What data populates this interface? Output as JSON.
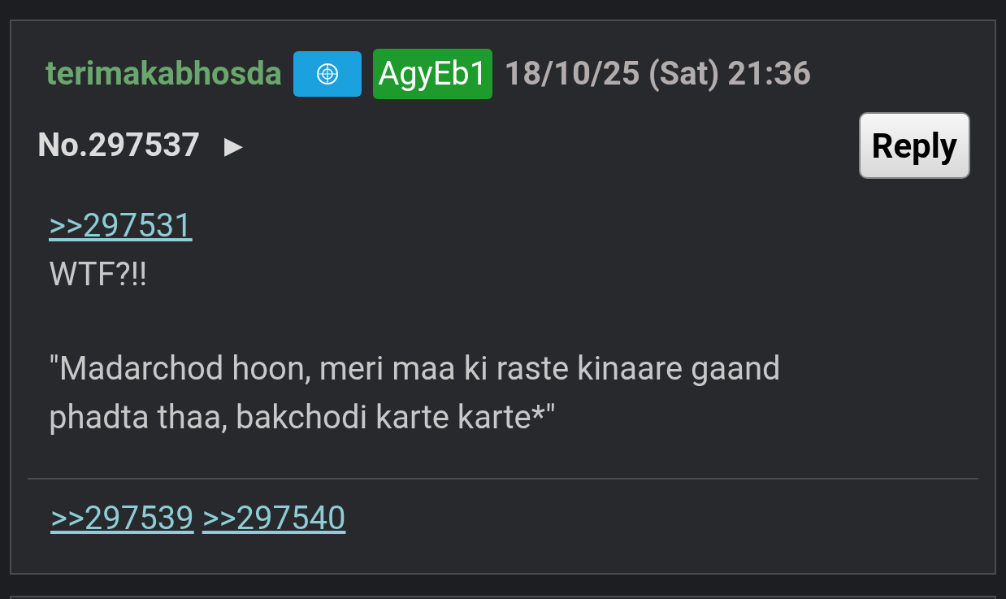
{
  "post": {
    "name": "terimakabhosda",
    "poster_id": "AgyEb1",
    "date": "18/10/25 (Sat) 21:36",
    "number": "No.297537",
    "expand_glyph": "▶",
    "reply_button": "Reply",
    "quote_link": ">>297531",
    "body": [
      "WTF?!!",
      " ″Madarchod hoon, meri maa ki raste kinaare gaand phadta thaa, bakchodi karte karte*\""
    ],
    "replies": [
      ">>297539",
      ">>297540"
    ]
  }
}
